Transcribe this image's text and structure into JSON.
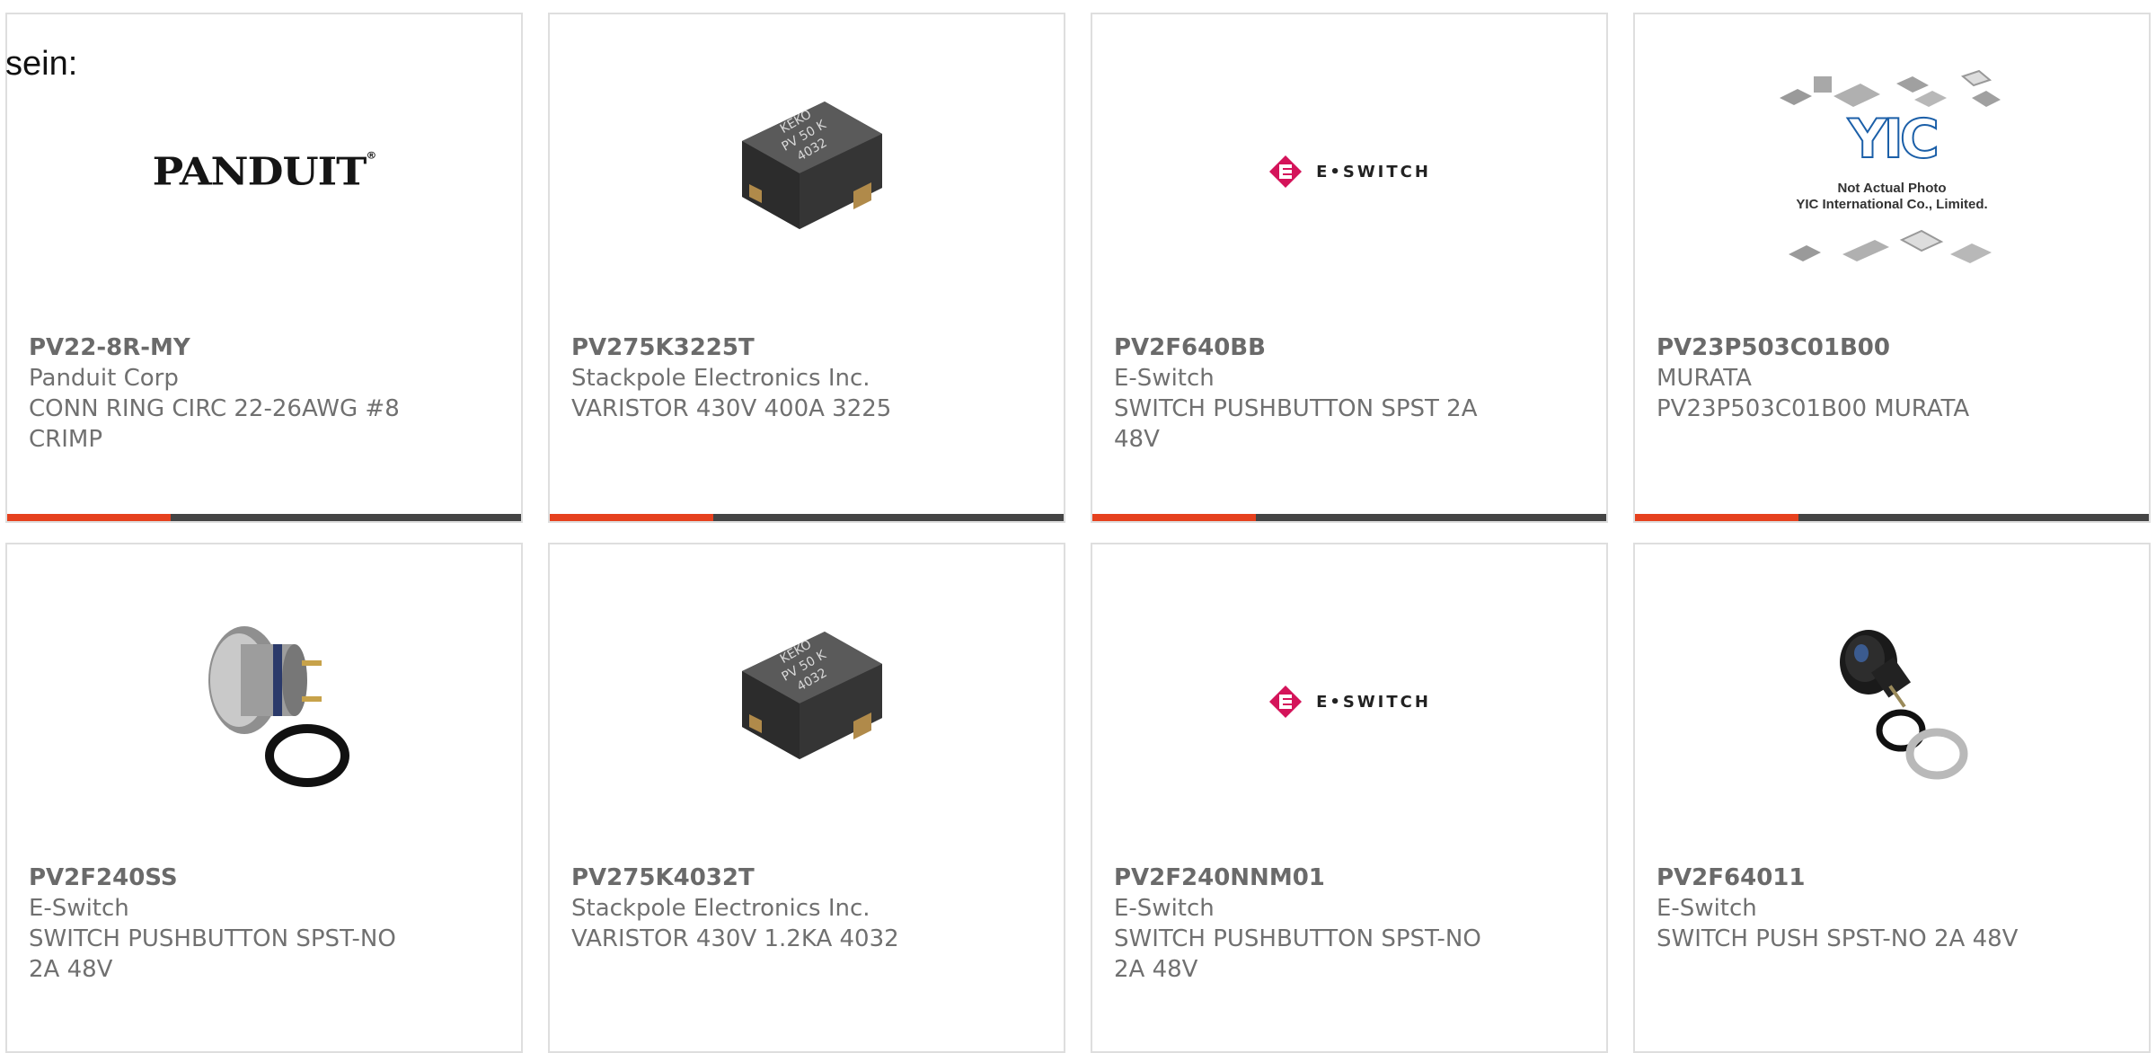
{
  "intro_text": "sein:",
  "brand_colors": {
    "accent": "#e6411e",
    "bar": "#444444",
    "border": "#dedede",
    "text": "#707070"
  },
  "products": [
    {
      "part_number": "PV22-8R-MY",
      "manufacturer": "Panduit Corp",
      "description": "CONN RING CIRC 22-26AWG #8 CRIMP",
      "image": "panduit-logo",
      "logo_text": "PANDUIT"
    },
    {
      "part_number": "PV275K3225T",
      "manufacturer": "Stackpole Electronics Inc.",
      "description": "VARISTOR 430V 400A 3225",
      "image": "varistor-photo",
      "image_print": "KEKO\nPV 50 K\n4032"
    },
    {
      "part_number": "PV2F640BB",
      "manufacturer": "E-Switch",
      "description": "SWITCH PUSHBUTTON SPST 2A 48V",
      "image": "eswitch-logo",
      "logo_text": "E•SWITCH"
    },
    {
      "part_number": "PV23P503C01B00",
      "manufacturer": "MURATA",
      "description": "PV23P503C01B00 MURATA",
      "image": "yic-placeholder",
      "logo_text": "YIC",
      "image_caption_line1": "Not Actual Photo",
      "image_caption_line2": "YIC International Co., Limited."
    },
    {
      "part_number": "PV2F240SS",
      "manufacturer": "E-Switch",
      "description": "SWITCH PUSHBUTTON SPST-NO 2A 48V",
      "image": "steel-pushbutton-photo"
    },
    {
      "part_number": "PV275K4032T",
      "manufacturer": "Stackpole Electronics Inc.",
      "description": "VARISTOR 430V 1.2KA 4032",
      "image": "varistor-photo",
      "image_print": "KEKO\nPV 50 K\n4032"
    },
    {
      "part_number": "PV2F240NNM01",
      "manufacturer": "E-Switch",
      "description": "SWITCH PUSHBUTTON SPST-NO 2A 48V",
      "image": "eswitch-logo",
      "logo_text": "E•SWITCH"
    },
    {
      "part_number": "PV2F64011",
      "manufacturer": "E-Switch",
      "description": "SWITCH PUSH SPST-NO 2A 48V",
      "image": "black-pushbutton-photo"
    }
  ]
}
